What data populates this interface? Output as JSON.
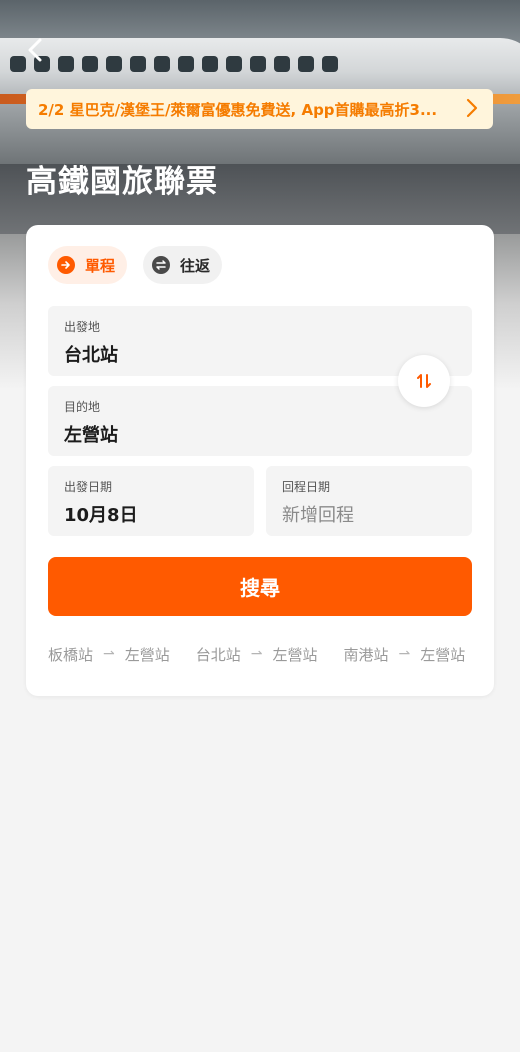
{
  "header": {
    "back_icon": "chevron-left-icon",
    "title": "高鐵國旅聯票"
  },
  "promo": {
    "text": "2/2 星巴克/漢堡王/萊爾富優惠免費送, App首購最高折3...",
    "icon": "chevron-right-icon"
  },
  "trip_type": {
    "options": [
      {
        "label": "單程",
        "icon": "arrow-right-circle-icon",
        "selected": true
      },
      {
        "label": "往返",
        "icon": "swap-circle-icon",
        "selected": false
      }
    ]
  },
  "form": {
    "origin_label": "出發地",
    "origin_value": "台北站",
    "destination_label": "目的地",
    "destination_value": "左營站",
    "depart_date_label": "出發日期",
    "depart_date_value": "10月8日",
    "return_date_label": "回程日期",
    "return_date_placeholder": "新增回程",
    "swap_icon": "swap-vertical-icon"
  },
  "search_label": "搜尋",
  "recent_searches": [
    {
      "from": "板橋站",
      "to": "左營站"
    },
    {
      "from": "台北站",
      "to": "左營站"
    },
    {
      "from": "南港站",
      "to": "左營站"
    }
  ],
  "colors": {
    "accent": "#ff5a00",
    "promo_bg": "#fff5dc",
    "promo_text": "#f57c00"
  }
}
